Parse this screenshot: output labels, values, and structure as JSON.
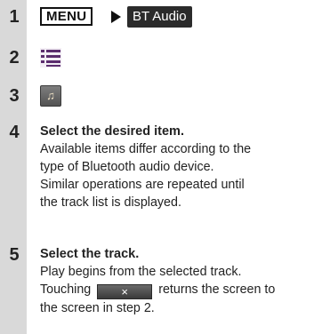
{
  "steps": [
    {
      "number": "1",
      "menu_key": "MENU",
      "arrow_icon": "right-triangle-icon",
      "target_key": "BT Audio"
    },
    {
      "number": "2",
      "icon": "list-icon"
    },
    {
      "number": "3",
      "icon": "music-note-icon",
      "icon_glyph": "♫"
    },
    {
      "number": "4",
      "title": "Select the desired item.",
      "lines": [
        "Available items differ according to the",
        "type of Bluetooth audio device.",
        "Similar operations are repeated until",
        "the track list is displayed."
      ]
    },
    {
      "number": "5",
      "title": "Select the track.",
      "line1": "Play begins from the selected track.",
      "line2_before": "Touching",
      "close_key": "×",
      "line2_after": "returns the screen to",
      "line3": "the screen in step 2."
    }
  ],
  "colors": {
    "stripe": "#d9d9d9",
    "list_icon_color": "#5b2d6e",
    "key_dark": "#2b2b2b"
  }
}
